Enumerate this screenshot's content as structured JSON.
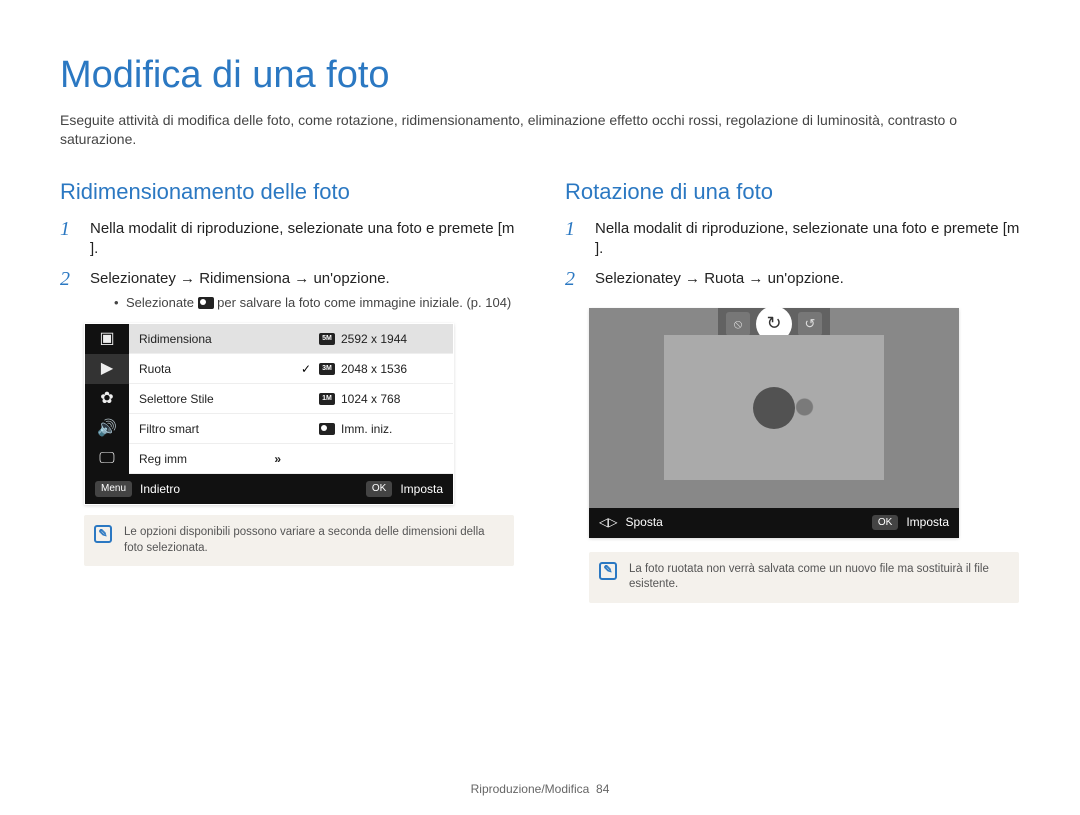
{
  "page_title": "Modifica di una foto",
  "intro": "Eseguite attività di modifica delle foto, come rotazione, ridimensionamento, eliminazione effetto occhi rossi, regolazione di luminosità, contrasto o saturazione.",
  "left": {
    "heading": "Ridimensionamento delle foto",
    "step1": "Nella modalit  di riproduzione, selezionate una foto e premete [m         ].",
    "step2": "Selezionatey        → Ridimensiona → un'opzione.",
    "bullet": "Selezionate        per salvare la foto come immagine iniziale. (p. 104)",
    "menu": {
      "left": [
        "Ridimensiona",
        "Ruota",
        "Selettore Stile",
        "Filtro smart",
        "Reg imm"
      ],
      "right": [
        {
          "glyph": "5M",
          "label": "2592 x 1944",
          "selected": true,
          "check": false
        },
        {
          "glyph": "3M",
          "label": "2048 x 1536",
          "selected": false,
          "check": true
        },
        {
          "glyph": "1M",
          "label": "1024 x 768",
          "selected": false,
          "check": false
        },
        {
          "glyph": "",
          "label": "Imm. iniz.",
          "selected": false,
          "check": false
        }
      ],
      "footer_left_tag": "Menu",
      "footer_left": "Indietro",
      "footer_right_tag": "OK",
      "footer_right": "Imposta"
    },
    "note": "Le opzioni disponibili possono variare a seconda delle dimensioni della foto selezionata."
  },
  "right": {
    "heading": "Rotazione di una foto",
    "step1": "Nella modalit  di riproduzione, selezionate una foto e premete [m         ].",
    "step2": "Selezionatey        → Ruota → un'opzione.",
    "footer_left": "Sposta",
    "footer_right_tag": "OK",
    "footer_right": "Imposta",
    "note": "La foto ruotata non verrà salvata come un nuovo file ma sostituirà il file esistente."
  },
  "footer": {
    "section": "Riproduzione/Modifica",
    "page": "84"
  }
}
